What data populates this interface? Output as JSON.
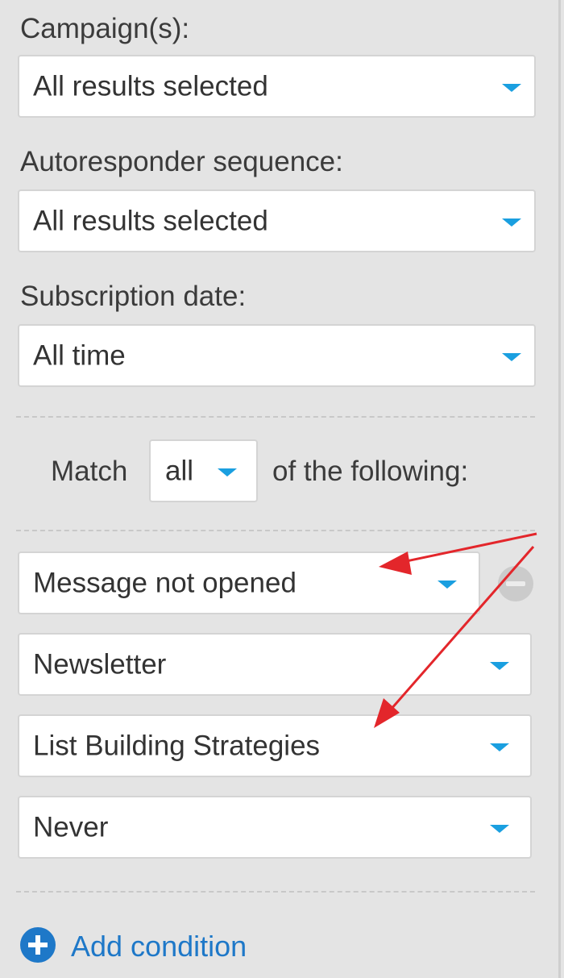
{
  "filters": {
    "campaigns": {
      "label": "Campaign(s):",
      "value": "All results selected"
    },
    "autoresponder": {
      "label": "Autoresponder sequence:",
      "value": "All results selected"
    },
    "subscription_date": {
      "label": "Subscription date:",
      "value": "All time"
    }
  },
  "match": {
    "prefix": "Match",
    "value": "all",
    "suffix": "of the following:"
  },
  "condition": {
    "type": "Message not opened",
    "message_kind": "Newsletter",
    "message": "List Building Strategies",
    "timeframe": "Never"
  },
  "add_condition_label": "Add condition",
  "colors": {
    "accent": "#1a9fe0",
    "link": "#1e78c8",
    "annotation_arrow": "#e3262b"
  },
  "icons": [
    "chevron-down-icon",
    "minus-circle-icon",
    "plus-circle-icon"
  ]
}
